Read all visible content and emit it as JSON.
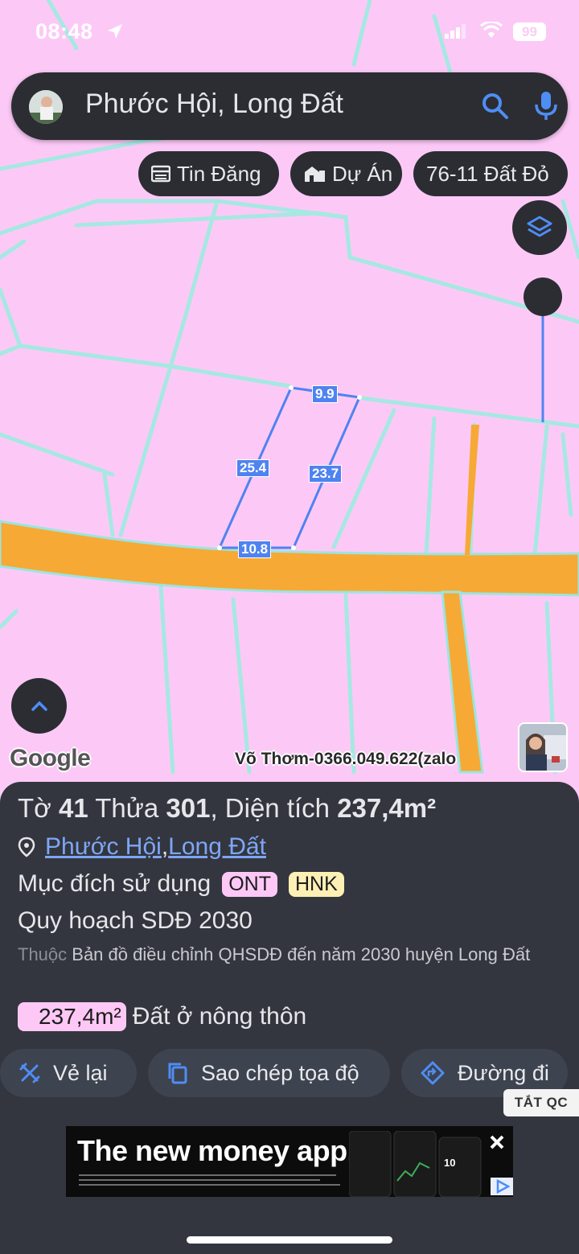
{
  "status": {
    "time": "08:48",
    "battery": "99"
  },
  "search": {
    "query": "Phước Hội, Long Đất"
  },
  "chips": {
    "listings": "Tin Đăng",
    "projects": "Dự Án",
    "saved": "76-11 Đất Đỏ"
  },
  "map": {
    "dimensions": {
      "top": "9.9",
      "left": "25.4",
      "right": "23.7",
      "bottom": "10.8"
    },
    "logo": "Google",
    "credit": "Võ Thơm-0366.049.622(zalo"
  },
  "parcel": {
    "title_pre": "Tờ ",
    "sheet_no": "41",
    "title_mid": " Thửa ",
    "parcel_no": "301",
    "title_mid2": ", Diện tích ",
    "area": "237,4m²",
    "ward": "Phước Hội",
    "separator": ", ",
    "district": "Long Đất",
    "purpose_label": "Mục đích sử dụng",
    "purpose_tags": [
      "ONT",
      "HNK"
    ],
    "plan_title": "Quy hoạch SDĐ 2030",
    "plan_desc_prefix": "Thuộc",
    "plan_desc": " Bản đồ điều chỉnh QHSDĐ đến năm 2030 huyện Long Đất",
    "zone_area": "237,4m²",
    "zone_name": "Đất ở nông thôn"
  },
  "actions": {
    "redraw": "Vẻ lại",
    "copy_coords": "Sao chép tọa độ",
    "directions": "Đường đi",
    "ad_off": "TẮT QC"
  },
  "ad": {
    "headline": "The new money app."
  },
  "colors": {
    "map_land": "#fcc9f7",
    "road": "#f7a936",
    "boundary": "#a6e8e2",
    "accent": "#4f83f0",
    "panel": "#33363e"
  }
}
